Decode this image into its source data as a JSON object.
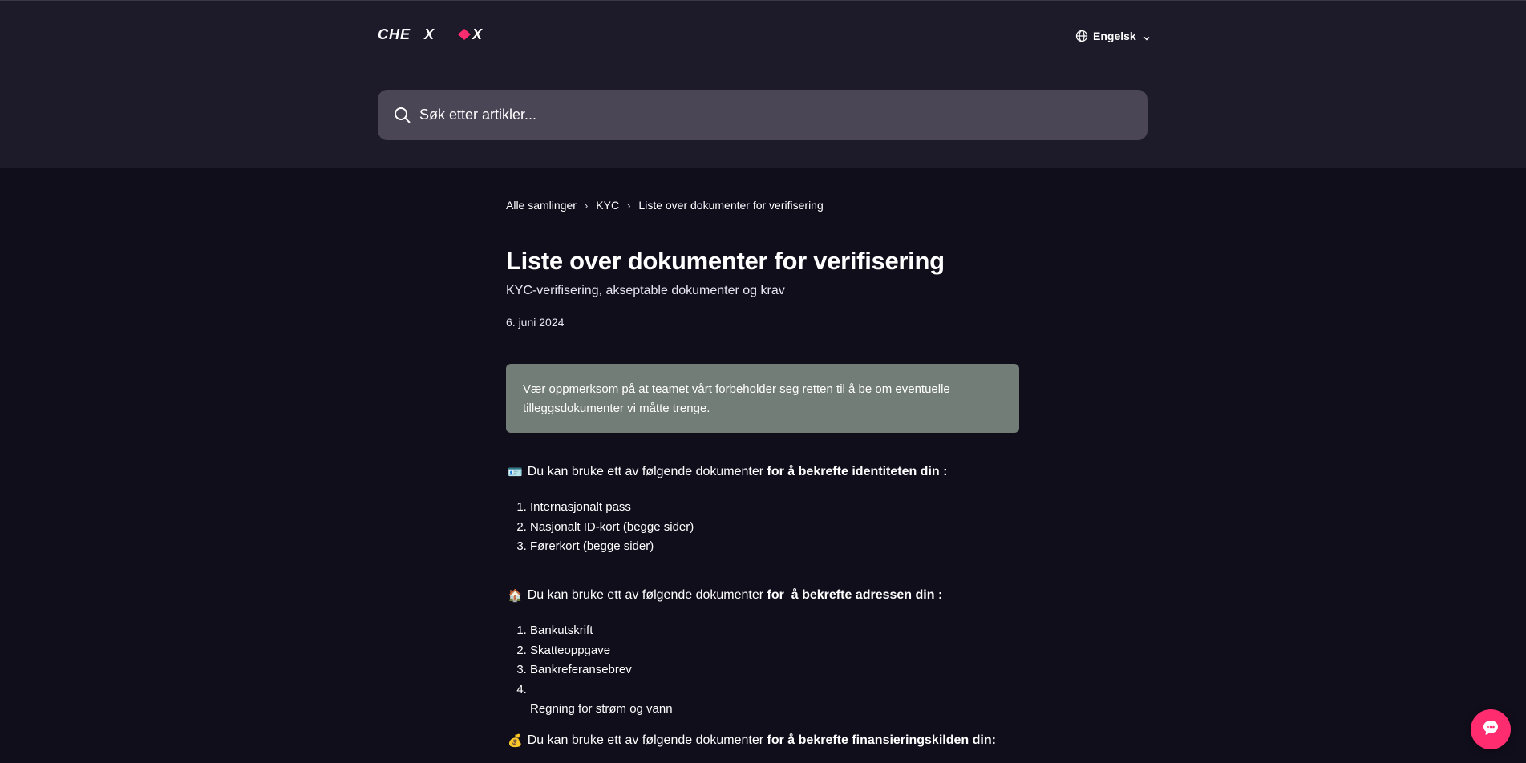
{
  "header": {
    "logo_text": "CHEXX",
    "language_label": "Engelsk"
  },
  "search": {
    "placeholder": "Søk etter artikler..."
  },
  "breadcrumb": {
    "items": [
      "Alle samlinger",
      "KYC",
      "Liste over dokumenter for verifisering"
    ],
    "separator": "›"
  },
  "article": {
    "title": "Liste over dokumenter for verifisering",
    "subtitle": "KYC-verifisering, akseptable dokumenter og krav",
    "date": "6. juni 2024",
    "callout": "Vær oppmerksom på at teamet vårt forbeholder seg retten til å be om eventuelle tilleggsdokumenter vi måtte trenge.",
    "sections": [
      {
        "emoji": "🪪",
        "text_plain": "Du kan bruke ett av følgende dokumenter ",
        "text_bold": "for å bekrefte identiteten din :",
        "items": [
          "Internasjonalt pass",
          "Nasjonalt ID-kort (begge sider)",
          "Førerkort (begge sider)"
        ]
      },
      {
        "emoji": "🏠",
        "text_plain": "Du kan bruke ett av følgende dokumenter ",
        "text_bold": "for  å bekrefte adressen din :",
        "items": [
          "Bankutskrift",
          "Skatteoppgave",
          "Bankreferansebrev",
          "",
          "Regning for strøm og vann"
        ]
      },
      {
        "emoji": "💰",
        "text_plain": "Du kan bruke ett av følgende dokumenter ",
        "text_bold": "for å bekrefte finansieringskilden din:"
      }
    ]
  },
  "colors": {
    "header_bg": "#1d1a2a",
    "page_bg": "#110e1c",
    "search_bg": "#4a4656",
    "callout_bg": "#737d78",
    "brand_accent": "#ff2d6f"
  }
}
